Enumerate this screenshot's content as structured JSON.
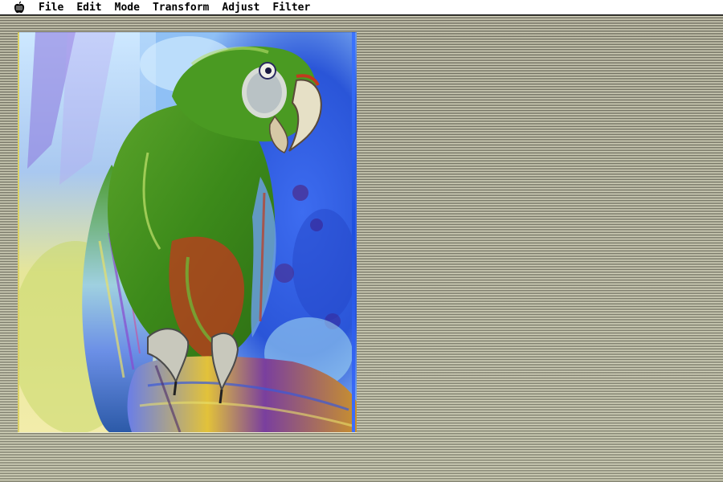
{
  "menubar": {
    "apple_icon": "apple-icon",
    "items": [
      {
        "label": "File"
      },
      {
        "label": "Edit"
      },
      {
        "label": "Mode"
      },
      {
        "label": "Transform"
      },
      {
        "label": "Adjust"
      },
      {
        "label": "Filter"
      }
    ]
  },
  "canvas": {
    "image_subject": "parrot-photo",
    "colors": {
      "background_blue": "#2a5fe6",
      "background_light": "#d9e98a",
      "parrot_green": "#3c8c1a",
      "parrot_red": "#c23a1e",
      "perch_purple": "#7a3f9e"
    }
  }
}
